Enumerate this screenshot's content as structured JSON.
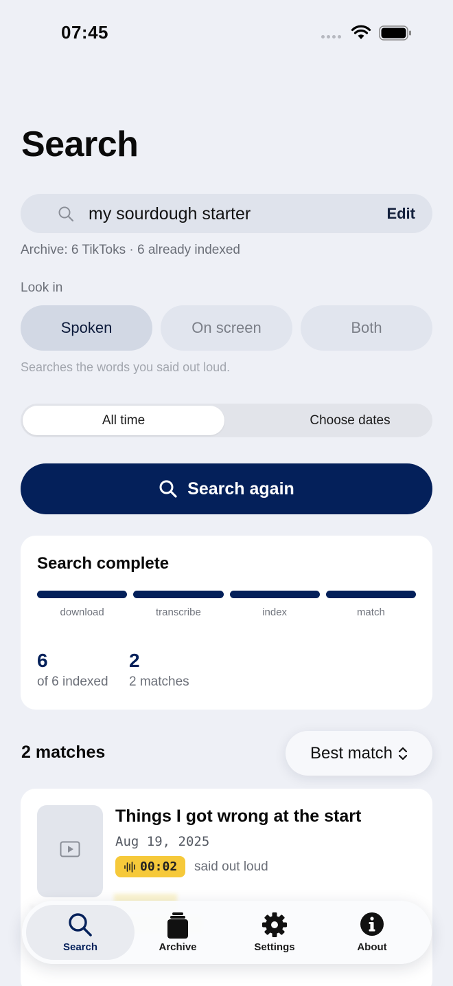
{
  "status": {
    "time": "07:45"
  },
  "page": {
    "title": "Search"
  },
  "search": {
    "query": "my sourdough starter",
    "edit_label": "Edit",
    "archive_info": "Archive: 6 TikToks · 6 already indexed"
  },
  "look_in": {
    "label": "Look in",
    "options": [
      {
        "label": "Spoken",
        "selected": true
      },
      {
        "label": "On screen",
        "selected": false
      },
      {
        "label": "Both",
        "selected": false
      }
    ],
    "hint": "Searches the words you said out loud."
  },
  "date_range": {
    "options": [
      {
        "label": "All time",
        "selected": true
      },
      {
        "label": "Choose dates",
        "selected": false
      }
    ]
  },
  "primary_action": {
    "label": "Search again"
  },
  "progress": {
    "title": "Search complete",
    "steps": [
      {
        "label": "download",
        "progress": 1.0
      },
      {
        "label": "transcribe",
        "progress": 1.0
      },
      {
        "label": "index",
        "progress": 1.0
      },
      {
        "label": "match",
        "progress": 1.0
      }
    ],
    "stats": [
      {
        "value": "6",
        "caption": "of 6 indexed"
      },
      {
        "value": "2",
        "caption": "2 matches"
      }
    ]
  },
  "results": {
    "heading": "2 matches",
    "sort_label": "Best match",
    "items": [
      {
        "title": "Things I got wrong at the start",
        "date": "Aug 19, 2025",
        "timestamp": "00:02",
        "source": "said out loud"
      }
    ]
  },
  "tabs": [
    {
      "label": "Search",
      "icon": "search-icon",
      "active": true
    },
    {
      "label": "Archive",
      "icon": "archive-icon",
      "active": false
    },
    {
      "label": "Settings",
      "icon": "gear-icon",
      "active": false
    },
    {
      "label": "About",
      "icon": "info-icon",
      "active": false
    }
  ],
  "colors": {
    "primary": "#04205a",
    "background": "#eef0f6",
    "badge": "#f6c93a"
  }
}
